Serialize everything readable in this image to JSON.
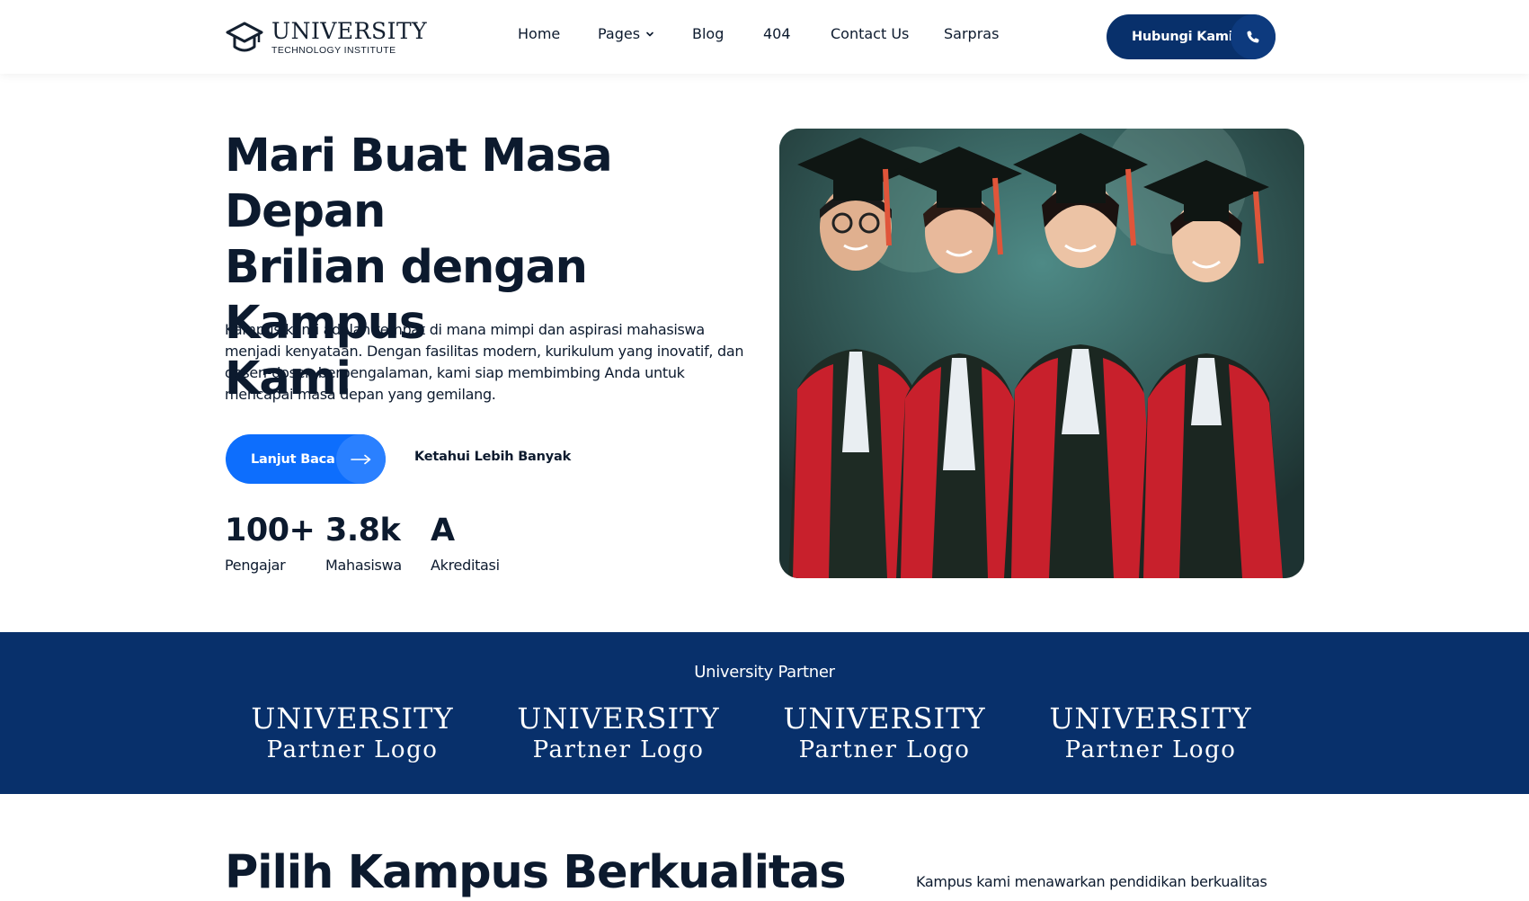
{
  "brand": {
    "title": "UNIVERSITY",
    "subtitle": "TECHNOLOGY INSTITUTE"
  },
  "nav": {
    "items": [
      "Home",
      "Pages",
      "Blog",
      "404",
      "Contact Us",
      "Sarpras"
    ],
    "cta_label": "Hubungi Kami"
  },
  "hero": {
    "title_lines": [
      "Mari Buat Masa Depan",
      "Brilian dengan Kampus",
      "Kami"
    ],
    "description": "Kampus kami adalah tempat di mana mimpi dan aspirasi mahasiswa menjadi kenyataan. Dengan fasilitas modern, kurikulum yang inovatif, dan dosen-dosen berpengalaman, kami siap membimbing Anda untuk mencapai masa depan yang gemilang.",
    "primary_button": "Lanjut Baca",
    "secondary_link": "Ketahui Lebih Banyak",
    "stats": [
      {
        "value": "100+",
        "label": "Pengajar"
      },
      {
        "value": "3.8k",
        "label": "Mahasiswa"
      },
      {
        "value": "A",
        "label": "Akreditasi"
      }
    ]
  },
  "partners": {
    "title": "University Partner",
    "logos": [
      {
        "line1": "UNIVERSITY",
        "line2": "Partner Logo"
      },
      {
        "line1": "UNIVERSITY",
        "line2": "Partner Logo"
      },
      {
        "line1": "UNIVERSITY",
        "line2": "Partner Logo"
      },
      {
        "line1": "UNIVERSITY",
        "line2": "Partner Logo"
      }
    ]
  },
  "section2": {
    "title": "Pilih Kampus Berkualitas",
    "description": "Kampus kami menawarkan pendidikan berkualitas"
  },
  "colors": {
    "navy": "#08306b",
    "primary_blue": "#0d6efd",
    "text_dark": "#0c1a2e"
  },
  "icons": {
    "logo": "graduation-cap-icon",
    "pages_dropdown": "chevron-down-icon",
    "cta": "phone-icon",
    "primary_button": "arrow-right-icon"
  }
}
